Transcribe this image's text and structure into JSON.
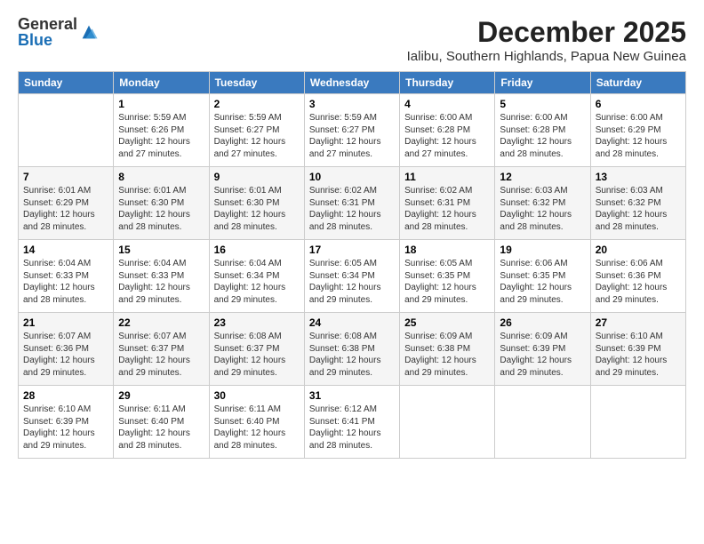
{
  "logo": {
    "general": "General",
    "blue": "Blue"
  },
  "title": "December 2025",
  "subtitle": "Ialibu, Southern Highlands, Papua New Guinea",
  "days_of_week": [
    "Sunday",
    "Monday",
    "Tuesday",
    "Wednesday",
    "Thursday",
    "Friday",
    "Saturday"
  ],
  "weeks": [
    [
      {
        "day": "",
        "info": ""
      },
      {
        "day": "1",
        "info": "Sunrise: 5:59 AM\nSunset: 6:26 PM\nDaylight: 12 hours\nand 27 minutes."
      },
      {
        "day": "2",
        "info": "Sunrise: 5:59 AM\nSunset: 6:27 PM\nDaylight: 12 hours\nand 27 minutes."
      },
      {
        "day": "3",
        "info": "Sunrise: 5:59 AM\nSunset: 6:27 PM\nDaylight: 12 hours\nand 27 minutes."
      },
      {
        "day": "4",
        "info": "Sunrise: 6:00 AM\nSunset: 6:28 PM\nDaylight: 12 hours\nand 27 minutes."
      },
      {
        "day": "5",
        "info": "Sunrise: 6:00 AM\nSunset: 6:28 PM\nDaylight: 12 hours\nand 28 minutes."
      },
      {
        "day": "6",
        "info": "Sunrise: 6:00 AM\nSunset: 6:29 PM\nDaylight: 12 hours\nand 28 minutes."
      }
    ],
    [
      {
        "day": "7",
        "info": "Sunrise: 6:01 AM\nSunset: 6:29 PM\nDaylight: 12 hours\nand 28 minutes."
      },
      {
        "day": "8",
        "info": "Sunrise: 6:01 AM\nSunset: 6:30 PM\nDaylight: 12 hours\nand 28 minutes."
      },
      {
        "day": "9",
        "info": "Sunrise: 6:01 AM\nSunset: 6:30 PM\nDaylight: 12 hours\nand 28 minutes."
      },
      {
        "day": "10",
        "info": "Sunrise: 6:02 AM\nSunset: 6:31 PM\nDaylight: 12 hours\nand 28 minutes."
      },
      {
        "day": "11",
        "info": "Sunrise: 6:02 AM\nSunset: 6:31 PM\nDaylight: 12 hours\nand 28 minutes."
      },
      {
        "day": "12",
        "info": "Sunrise: 6:03 AM\nSunset: 6:32 PM\nDaylight: 12 hours\nand 28 minutes."
      },
      {
        "day": "13",
        "info": "Sunrise: 6:03 AM\nSunset: 6:32 PM\nDaylight: 12 hours\nand 28 minutes."
      }
    ],
    [
      {
        "day": "14",
        "info": "Sunrise: 6:04 AM\nSunset: 6:33 PM\nDaylight: 12 hours\nand 28 minutes."
      },
      {
        "day": "15",
        "info": "Sunrise: 6:04 AM\nSunset: 6:33 PM\nDaylight: 12 hours\nand 29 minutes."
      },
      {
        "day": "16",
        "info": "Sunrise: 6:04 AM\nSunset: 6:34 PM\nDaylight: 12 hours\nand 29 minutes."
      },
      {
        "day": "17",
        "info": "Sunrise: 6:05 AM\nSunset: 6:34 PM\nDaylight: 12 hours\nand 29 minutes."
      },
      {
        "day": "18",
        "info": "Sunrise: 6:05 AM\nSunset: 6:35 PM\nDaylight: 12 hours\nand 29 minutes."
      },
      {
        "day": "19",
        "info": "Sunrise: 6:06 AM\nSunset: 6:35 PM\nDaylight: 12 hours\nand 29 minutes."
      },
      {
        "day": "20",
        "info": "Sunrise: 6:06 AM\nSunset: 6:36 PM\nDaylight: 12 hours\nand 29 minutes."
      }
    ],
    [
      {
        "day": "21",
        "info": "Sunrise: 6:07 AM\nSunset: 6:36 PM\nDaylight: 12 hours\nand 29 minutes."
      },
      {
        "day": "22",
        "info": "Sunrise: 6:07 AM\nSunset: 6:37 PM\nDaylight: 12 hours\nand 29 minutes."
      },
      {
        "day": "23",
        "info": "Sunrise: 6:08 AM\nSunset: 6:37 PM\nDaylight: 12 hours\nand 29 minutes."
      },
      {
        "day": "24",
        "info": "Sunrise: 6:08 AM\nSunset: 6:38 PM\nDaylight: 12 hours\nand 29 minutes."
      },
      {
        "day": "25",
        "info": "Sunrise: 6:09 AM\nSunset: 6:38 PM\nDaylight: 12 hours\nand 29 minutes."
      },
      {
        "day": "26",
        "info": "Sunrise: 6:09 AM\nSunset: 6:39 PM\nDaylight: 12 hours\nand 29 minutes."
      },
      {
        "day": "27",
        "info": "Sunrise: 6:10 AM\nSunset: 6:39 PM\nDaylight: 12 hours\nand 29 minutes."
      }
    ],
    [
      {
        "day": "28",
        "info": "Sunrise: 6:10 AM\nSunset: 6:39 PM\nDaylight: 12 hours\nand 29 minutes."
      },
      {
        "day": "29",
        "info": "Sunrise: 6:11 AM\nSunset: 6:40 PM\nDaylight: 12 hours\nand 28 minutes."
      },
      {
        "day": "30",
        "info": "Sunrise: 6:11 AM\nSunset: 6:40 PM\nDaylight: 12 hours\nand 28 minutes."
      },
      {
        "day": "31",
        "info": "Sunrise: 6:12 AM\nSunset: 6:41 PM\nDaylight: 12 hours\nand 28 minutes."
      },
      {
        "day": "",
        "info": ""
      },
      {
        "day": "",
        "info": ""
      },
      {
        "day": "",
        "info": ""
      }
    ]
  ]
}
